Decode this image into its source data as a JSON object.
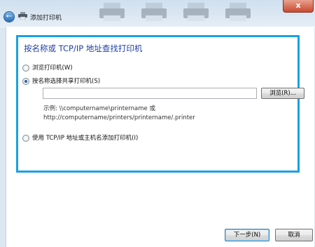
{
  "window": {
    "title": "添加打印机",
    "close_label": "x"
  },
  "page": {
    "heading": "按名称或 TCP/IP 地址查找打印机"
  },
  "options": [
    {
      "label": "浏览打印机(W)",
      "checked": false
    },
    {
      "label": "按名称选择共享打印机(S)",
      "checked": true
    },
    {
      "label": "使用 TCP/IP 地址或主机名添加打印机(I)",
      "checked": false
    }
  ],
  "share_path": {
    "value": "",
    "browse_label": "浏览(R)..."
  },
  "example": {
    "line1": "示例: \\\\computername\\printername 或",
    "line2": "http://computername/printers/printername/.printer"
  },
  "footer": {
    "next_label": "下一步(N)",
    "cancel_label": "取消"
  }
}
